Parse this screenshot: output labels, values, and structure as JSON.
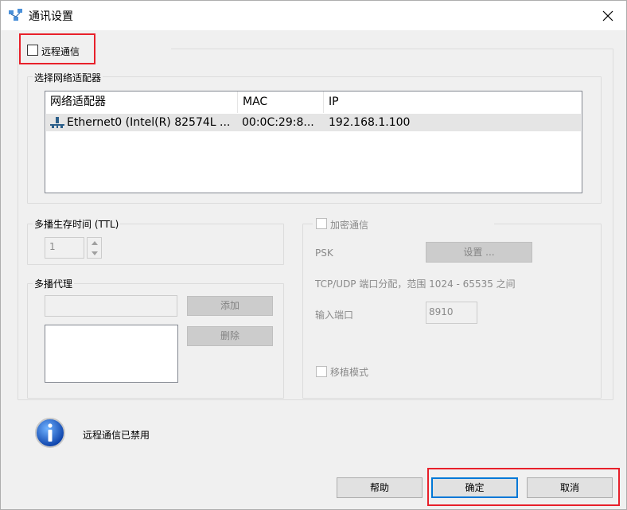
{
  "window": {
    "title": "通讯设置"
  },
  "remote": {
    "checkbox_label": "远程通信"
  },
  "adapters": {
    "group_label": "选择网络适配器",
    "columns": [
      "网络适配器",
      "MAC",
      "IP"
    ],
    "rows": [
      {
        "name": "Ethernet0 (Intel(R) 82574L ...",
        "mac": "00:0C:29:8...",
        "ip": "192.168.1.100"
      }
    ]
  },
  "ttl": {
    "group_label": "多播生存时间 (TTL)",
    "value": "1"
  },
  "proxy": {
    "group_label": "多播代理",
    "add_label": "添加",
    "delete_label": "删除"
  },
  "encrypt": {
    "checkbox_label": "加密通信",
    "psk_label": "PSK",
    "settings_label": "设置 ...",
    "port_range_text": "TCP/UDP 端口分配，范围 1024 - 65535 之间",
    "port_label": "输入端口",
    "port_value": "8910",
    "portable_label": "移植模式"
  },
  "status": {
    "text": "远程通信已禁用"
  },
  "buttons": {
    "help": "帮助",
    "ok": "确定",
    "cancel": "取消"
  }
}
